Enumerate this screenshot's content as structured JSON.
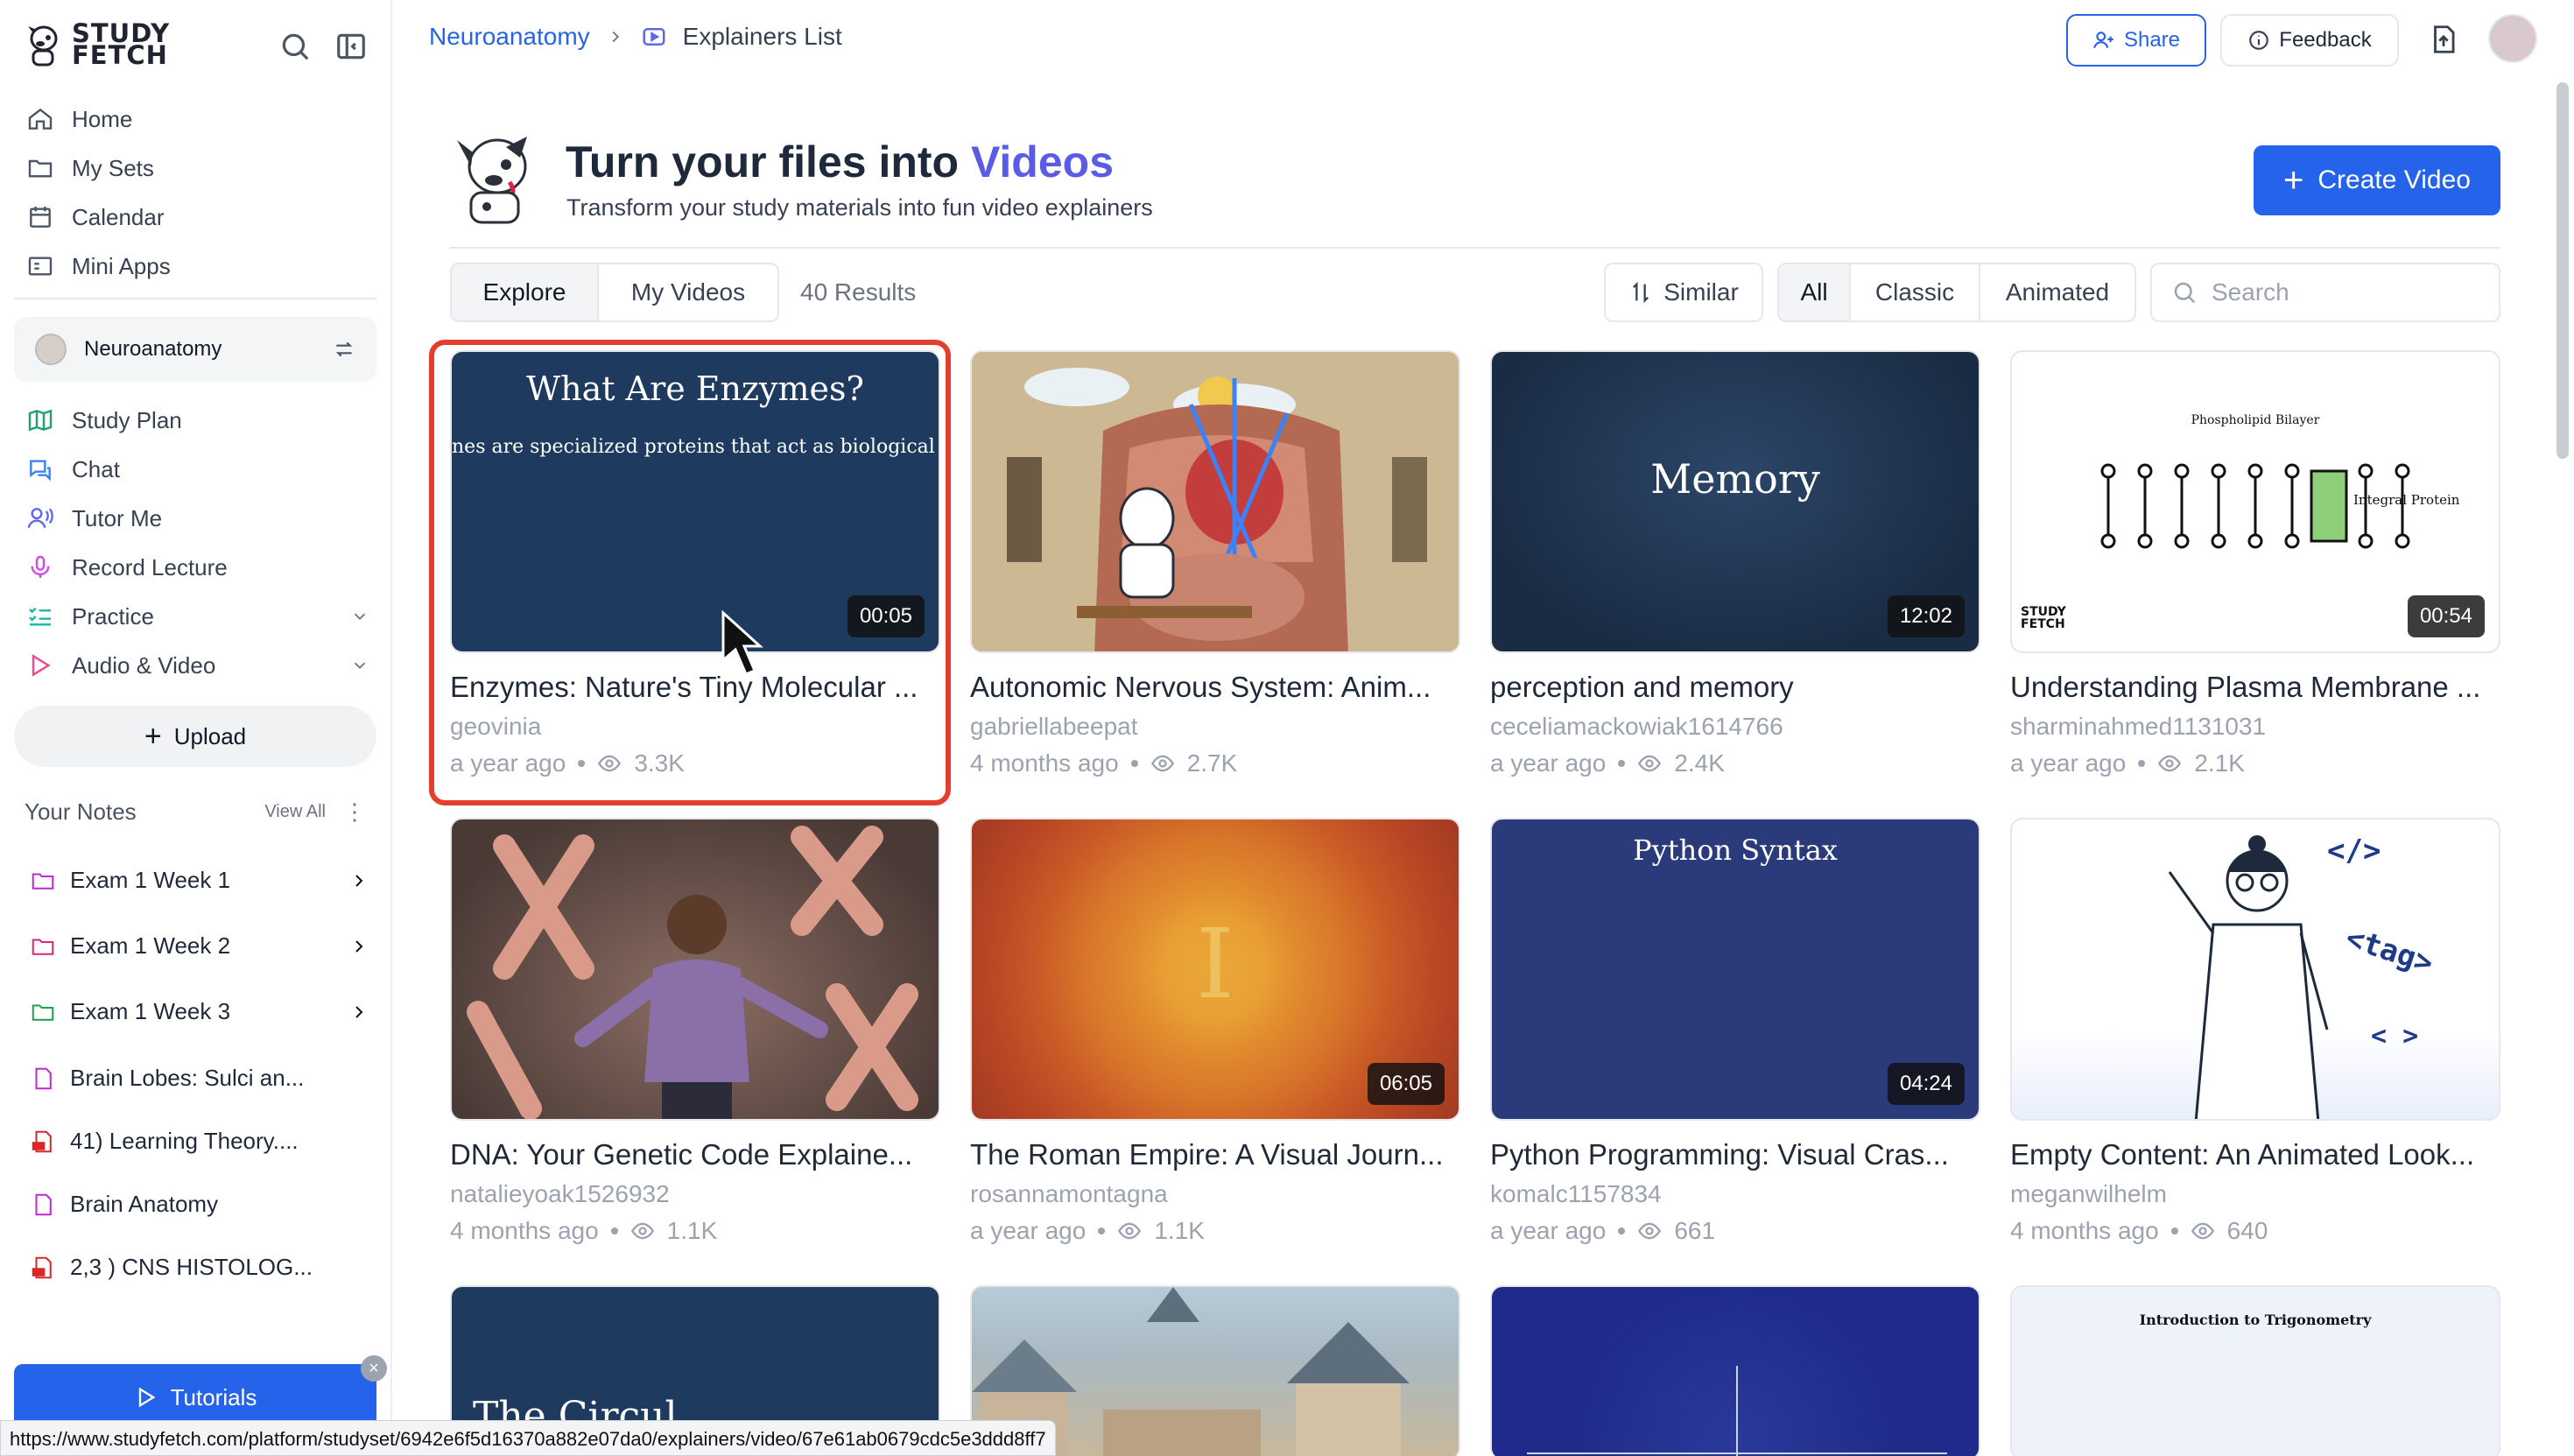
{
  "sidebar": {
    "logo_text_1": "STUDY",
    "logo_text_2": "FETCH",
    "nav": [
      {
        "label": "Home",
        "icon": "home-icon"
      },
      {
        "label": "My Sets",
        "icon": "folder-icon"
      },
      {
        "label": "Calendar",
        "icon": "calendar-icon"
      },
      {
        "label": "Mini Apps",
        "icon": "apps-icon"
      }
    ],
    "set_name": "Neuroanatomy",
    "tools": [
      {
        "label": "Study Plan",
        "icon": "map-icon"
      },
      {
        "label": "Chat",
        "icon": "chat-icon"
      },
      {
        "label": "Tutor Me",
        "icon": "tutor-icon"
      },
      {
        "label": "Record Lecture",
        "icon": "mic-icon"
      },
      {
        "label": "Practice",
        "icon": "checklist-icon"
      },
      {
        "label": "Audio & Video",
        "icon": "play-icon"
      }
    ],
    "upload_label": "Upload",
    "notes_title": "Your Notes",
    "view_all": "View All",
    "notes": [
      {
        "label": "Exam 1 Week 1"
      },
      {
        "label": "Exam 1 Week 2"
      },
      {
        "label": "Exam 1 Week 3"
      },
      {
        "label": "Brain Lobes: Sulci an..."
      },
      {
        "label": "41) Learning Theory...."
      },
      {
        "label": "Brain Anatomy"
      },
      {
        "label": "2,3 ) CNS HISTOLOG..."
      }
    ],
    "tutorials_label": "Tutorials",
    "close_glyph": "×"
  },
  "status_url": "https://www.studyfetch.com/platform/studyset/6942e6f5d16370a882e07da0/explainers/video/67e61ab0679cdc5e3ddd8ff7",
  "header": {
    "crumb_1": "Neuroanatomy",
    "crumb_2": "Explainers List",
    "share_label": "Share",
    "feedback_label": "Feedback"
  },
  "hero": {
    "title_1": "Turn your files into ",
    "title_accent": "Videos",
    "subtitle": "Transform your study materials into fun video explainers",
    "create_label": "Create Video"
  },
  "filters": {
    "tab_explore": "Explore",
    "tab_my_videos": "My Videos",
    "results": "40 Results",
    "similar": "Similar",
    "type_all": "All",
    "type_classic": "Classic",
    "type_animated": "Animated",
    "search_placeholder": "Search"
  },
  "cards": [
    {
      "title": "Enzymes: Nature's Tiny Molecular ...",
      "author": "geovinia",
      "age": "a year ago",
      "views": "3.3K",
      "duration": "00:05",
      "thumb_title": "What Are Enzymes?",
      "thumb_sub": "nes are specialized proteins that act as biological cat"
    },
    {
      "title": "Autonomic Nervous System: Anim...",
      "author": "gabriellabeepat",
      "age": "4 months ago",
      "views": "2.7K",
      "duration": ""
    },
    {
      "title": "perception and memory",
      "author": "ceceliamackowiak1614766",
      "age": "a year ago",
      "views": "2.4K",
      "duration": "12:02",
      "thumb_title": "Memory"
    },
    {
      "title": "Understanding Plasma Membrane ...",
      "author": "sharminahmed1131031",
      "age": "a year ago",
      "views": "2.1K",
      "duration": "00:54",
      "thumb_title": "Phospholipid Bilayer",
      "thumb_sub": "Integral Protein",
      "thumb_logo": "STUDY FETCH"
    },
    {
      "title": "DNA: Your Genetic Code Explaine...",
      "author": "natalieyoak1526932",
      "age": "4 months ago",
      "views": "1.1K",
      "duration": ""
    },
    {
      "title": "The Roman Empire: A Visual Journ...",
      "author": "rosannamontagna",
      "age": "a year ago",
      "views": "1.1K",
      "duration": "06:05",
      "thumb_title": "I"
    },
    {
      "title": "Python Programming: Visual Cras...",
      "author": "komalc1157834",
      "age": "a year ago",
      "views": "661",
      "duration": "04:24",
      "thumb_title": "Python Syntax"
    },
    {
      "title": "Empty Content: An Animated Look...",
      "author": "meganwilhelm",
      "age": "4 months ago",
      "views": "640",
      "duration": "",
      "thumb_tags": [
        "</>",
        "<tag>",
        "< >"
      ]
    },
    {
      "thumb_title": "The Circul..."
    },
    {},
    {},
    {
      "thumb_title": "Introduction to Trigonometry"
    }
  ],
  "colors": {
    "accent": "#2563eb",
    "title_accent": "#5b5ce6",
    "highlight": "#e53e2e"
  }
}
